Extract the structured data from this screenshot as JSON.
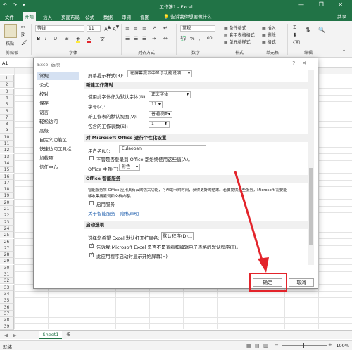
{
  "app": {
    "title": "工作簿1 - Excel",
    "accent": "#217346",
    "quick_access": "↶ ↷ ▾",
    "window_controls": "— ❐ ✕"
  },
  "ribbon_tabs": {
    "items": [
      "文件",
      "开始",
      "插入",
      "页面布局",
      "公式",
      "数据",
      "审阅",
      "视图",
      "帮助"
    ],
    "active_index": 1,
    "tell_me": "告诉我你想要做什么",
    "share": "共享"
  },
  "ribbon": {
    "clipboard_label": "剪贴板",
    "paste": "粘贴",
    "font_name": "等线",
    "font_size": "11",
    "font_label": "字体",
    "alignment_label": "对齐方式",
    "number_format": "常规",
    "number_label": "数字",
    "styles": {
      "conditional": "条件格式",
      "table": "套用表格格式",
      "cell": "单元格样式",
      "label": "样式"
    },
    "cells": {
      "insert": "插入",
      "delete": "删除",
      "format": "格式",
      "label": "单元格"
    },
    "editing_label": "编辑"
  },
  "formula_bar": {
    "name_box": "A1",
    "fx": "fx"
  },
  "grid": {
    "rows": [
      "1",
      "2",
      "3",
      "4",
      "5",
      "6",
      "7",
      "8",
      "9",
      "10",
      "11",
      "12",
      "13",
      "14",
      "15",
      "16",
      "17",
      "18",
      "19",
      "20",
      "21",
      "22",
      "23",
      "24",
      "25",
      "26",
      "27",
      "28",
      "29",
      "30",
      "31",
      "32",
      "33",
      "34",
      "35",
      "36",
      "37",
      "38",
      "39"
    ]
  },
  "sheets": {
    "items": [
      "Sheet1"
    ],
    "add": "⊕"
  },
  "status": {
    "text": "就绪",
    "zoom": "100%"
  },
  "dialog": {
    "title": "Excel 选项",
    "help": "?",
    "close": "✕",
    "nav": [
      "常规",
      "公式",
      "校对",
      "保存",
      "语言",
      "轻松访问",
      "高级",
      "自定义功能区",
      "快速访问工具栏",
      "加载项",
      "信任中心"
    ],
    "nav_selected": 0,
    "screentip_label": "屏幕提示样式(R):",
    "screentip_value": "在屏幕提示中显示功能说明",
    "new_workbook": {
      "header": "新建工作簿时",
      "font_label": "使用此字体作为默认字体(N):",
      "font_value": "正文字体",
      "size_label": "字号(Z):",
      "size_value": "11",
      "view_label": "新工作表的默认视图(V):",
      "view_value": "普通视图",
      "sheets_label": "包含的工作表数(S):",
      "sheets_value": "1"
    },
    "personalize": {
      "header": "对 Microsoft Office 进行个性化设置",
      "username_label": "用户名(U):",
      "username_value": "Eulaoban",
      "always_use": "不管是否登录到 Office 都始终使用这些值(A)。",
      "theme_label": "Office 主题(T):",
      "theme_value": "彩色"
    },
    "intelligent": {
      "header": "Office 智能服务",
      "desc1": "智能服务将 Office 应用具有云的强大功能，可帮助节约时间，获得更好的结果。若要提供这些服务，Microsoft 需要能",
      "desc2": "够收集搜索词和文档内容。",
      "enable": "启用服务",
      "about_link": "关于智能服务",
      "privacy_link": "隐私声明"
    },
    "startup": {
      "header": "启动选项",
      "ext_label": "选择您希望 Excel 默认打开扩展名:",
      "default_programs": "默认程序(D)...",
      "tell_me_if": "告诉我 Microsoft Excel 是否不是查看和编辑电子表格的默认程序(T)。",
      "show_start": "此应用程序启动时显示开始屏幕(H)"
    },
    "ok": "确定",
    "cancel": "取消"
  },
  "annotation": {
    "color": "#e3242b"
  }
}
